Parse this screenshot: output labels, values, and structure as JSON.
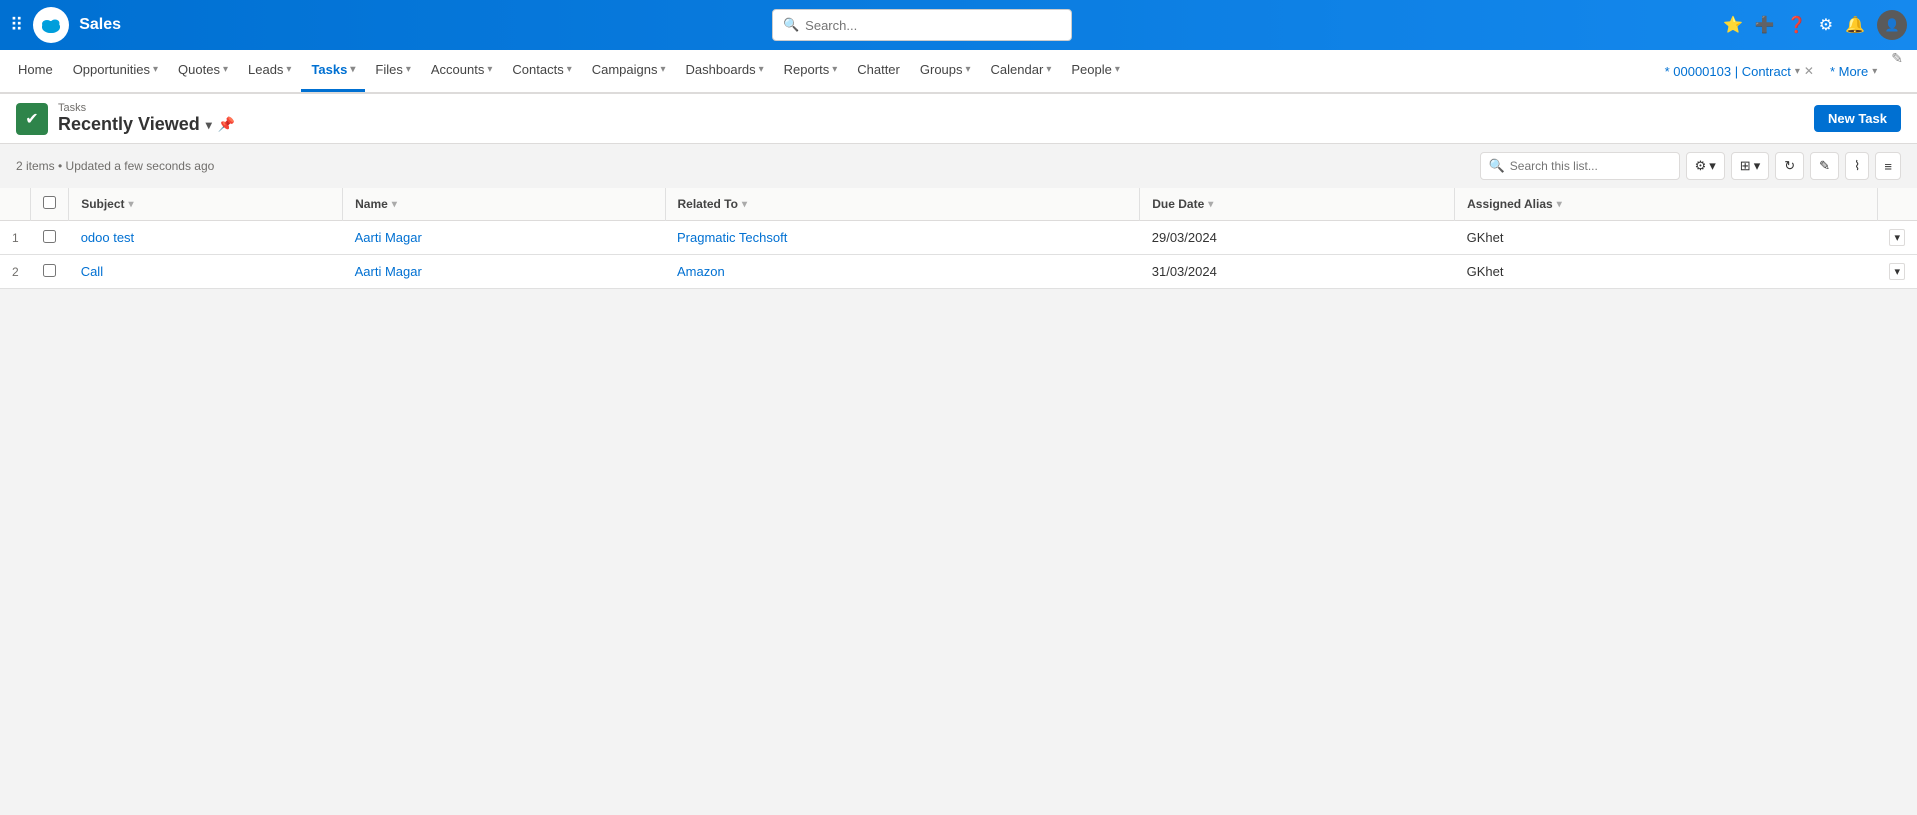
{
  "app": {
    "name": "Sales",
    "logo_alt": "Salesforce"
  },
  "search": {
    "placeholder": "Search...",
    "list_placeholder": "Search this list..."
  },
  "nav": {
    "items": [
      {
        "label": "Home",
        "has_chevron": false,
        "active": false
      },
      {
        "label": "Opportunities",
        "has_chevron": true,
        "active": false
      },
      {
        "label": "Quotes",
        "has_chevron": true,
        "active": false
      },
      {
        "label": "Leads",
        "has_chevron": true,
        "active": false
      },
      {
        "label": "Tasks",
        "has_chevron": true,
        "active": true
      },
      {
        "label": "Files",
        "has_chevron": true,
        "active": false
      },
      {
        "label": "Accounts",
        "has_chevron": true,
        "active": false
      },
      {
        "label": "Contacts",
        "has_chevron": true,
        "active": false
      },
      {
        "label": "Campaigns",
        "has_chevron": true,
        "active": false
      },
      {
        "label": "Dashboards",
        "has_chevron": true,
        "active": false
      },
      {
        "label": "Reports",
        "has_chevron": true,
        "active": false
      },
      {
        "label": "Chatter",
        "has_chevron": false,
        "active": false
      },
      {
        "label": "Groups",
        "has_chevron": true,
        "active": false
      },
      {
        "label": "Calendar",
        "has_chevron": true,
        "active": false
      },
      {
        "label": "People",
        "has_chevron": true,
        "active": false
      }
    ],
    "pinned_label": "* 00000103 | Contract",
    "more_label": "* More"
  },
  "page": {
    "subtitle": "Tasks",
    "title": "Recently Viewed",
    "status": "2 items • Updated a few seconds ago",
    "new_task_label": "New Task"
  },
  "table": {
    "columns": [
      {
        "label": "Subject",
        "sortable": true
      },
      {
        "label": "Name",
        "sortable": true
      },
      {
        "label": "Related To",
        "sortable": true
      },
      {
        "label": "Due Date",
        "sortable": true
      },
      {
        "label": "Assigned Alias",
        "sortable": true
      }
    ],
    "rows": [
      {
        "num": "1",
        "subject": "odoo test",
        "name": "Aarti Magar",
        "related_to": "Pragmatic Techsoft",
        "due_date": "29/03/2024",
        "assigned_alias": "GKhet"
      },
      {
        "num": "2",
        "subject": "Call",
        "name": "Aarti Magar",
        "related_to": "Amazon",
        "due_date": "31/03/2024",
        "assigned_alias": "GKhet"
      }
    ]
  },
  "toolbar_icons": {
    "gear": "⚙",
    "grid": "⊞",
    "refresh": "↻",
    "edit": "✎",
    "chart": "⌇",
    "filter": "≡"
  }
}
